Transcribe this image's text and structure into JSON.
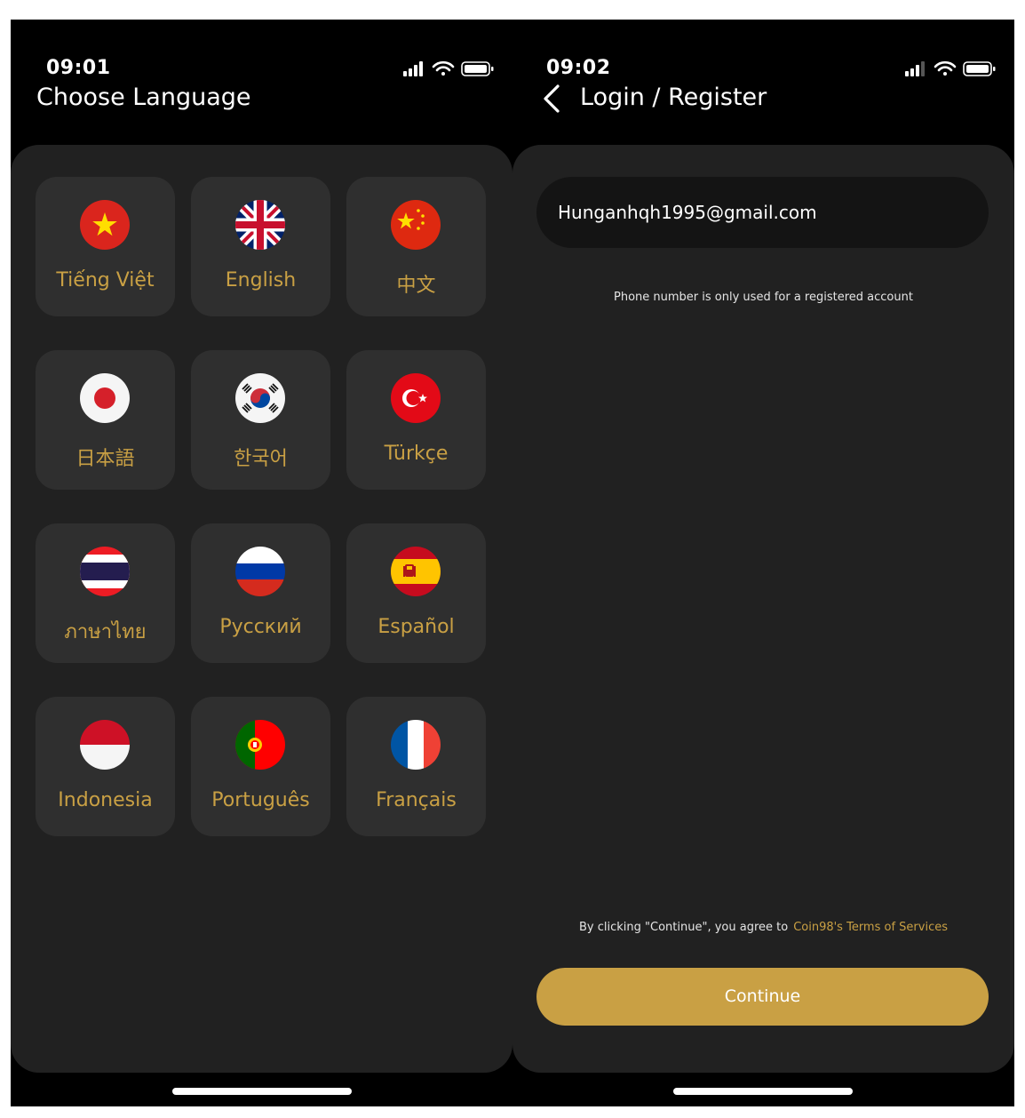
{
  "left_screen": {
    "status": {
      "time": "09:01"
    },
    "title": "Choose Language",
    "languages": [
      {
        "label": "Tiếng Việt",
        "flag": "vietnam-flag-icon"
      },
      {
        "label": "English",
        "flag": "uk-flag-icon"
      },
      {
        "label": "中文",
        "flag": "china-flag-icon"
      },
      {
        "label": "日本語",
        "flag": "japan-flag-icon"
      },
      {
        "label": "한국어",
        "flag": "korea-flag-icon"
      },
      {
        "label": "Türkçe",
        "flag": "turkey-flag-icon"
      },
      {
        "label": "ภาษาไทย",
        "flag": "thailand-flag-icon"
      },
      {
        "label": "Русский",
        "flag": "russia-flag-icon"
      },
      {
        "label": "Español",
        "flag": "spain-flag-icon"
      },
      {
        "label": "Indonesia",
        "flag": "indonesia-flag-icon"
      },
      {
        "label": "Português",
        "flag": "portugal-flag-icon"
      },
      {
        "label": "Français",
        "flag": "france-flag-icon"
      }
    ]
  },
  "right_screen": {
    "status": {
      "time": "09:02"
    },
    "title": "Login / Register",
    "email_value": "Hunganhqh1995@gmail.com",
    "hint": "Phone number is only used for a registered account",
    "agree_text": "By clicking \"Continue\", you agree to",
    "terms_link": "Coin98's Terms of Services",
    "continue_label": "Continue"
  },
  "colors": {
    "accent": "#c9a044",
    "panel": "#212121",
    "tile": "#2f2f2f",
    "background": "#000000"
  }
}
